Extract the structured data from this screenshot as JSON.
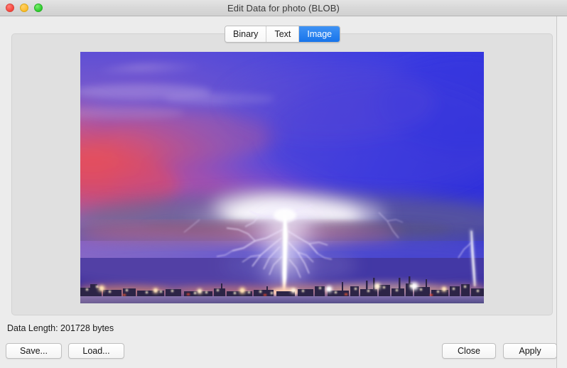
{
  "window": {
    "title": "Edit Data for photo (BLOB)",
    "traffic_lights": [
      {
        "name": "close",
        "color": "#f6443b"
      },
      {
        "name": "minimize",
        "color": "#fdbc2b"
      },
      {
        "name": "maximize",
        "color": "#2dcb2d"
      }
    ]
  },
  "tabs": {
    "items": [
      {
        "label": "Binary",
        "active": false
      },
      {
        "label": "Text",
        "active": false
      },
      {
        "label": "Image",
        "active": true
      }
    ],
    "selected": "Image",
    "accent_color": "#1874ea"
  },
  "preview": {
    "alt": "Lightning bolt striking over a city skyline at dusk reflected in water",
    "description": "Photo of a large white lightning strike descending from storm clouds onto a distant illuminated city skyline, with red and purple sunset clouds on the left, deep blue sky on the right, and the scene mirrored in calm water"
  },
  "footer": {
    "data_length": "Data Length: 201728 bytes",
    "save_label": "Save...",
    "load_label": "Load...",
    "close_label": "Close",
    "apply_label": "Apply"
  }
}
